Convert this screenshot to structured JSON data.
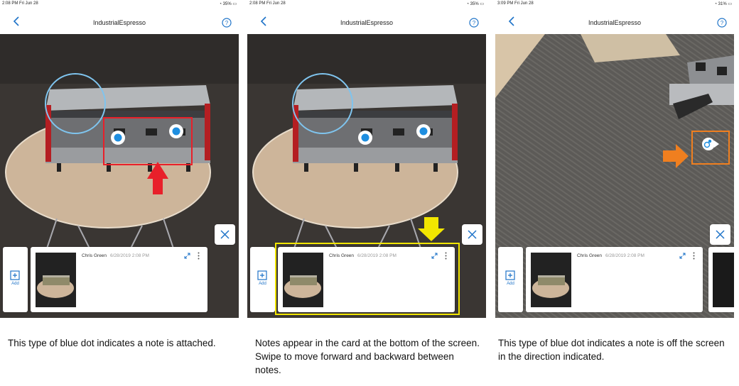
{
  "panels": [
    {
      "status_time": "2:08 PM  Fri Jun 28",
      "status_right": "35%",
      "title": "IndustrialEspresso",
      "add_label": "Add",
      "note_author": "Chris Green",
      "note_date": "6/28/2019 2:08 PM",
      "caption": "This type of blue dot indicates a note is attached."
    },
    {
      "status_time": "2:08 PM  Fri Jun 28",
      "status_right": "35%",
      "title": "IndustrialEspresso",
      "add_label": "Add",
      "note_author": "Chris Green",
      "note_date": "6/28/2019 2:08 PM",
      "caption": "Notes appear in the card at the bottom of the screen. Swipe to move forward and backward between notes."
    },
    {
      "status_time": "3:09 PM  Fri Jun 28",
      "status_right": "31%",
      "title": "IndustrialEspresso",
      "add_label": "Add",
      "note_author": "Chris Green",
      "note_date": "6/28/2019 2:08 PM",
      "caption": "This type of blue dot indicates a note is off the screen in the direction indicated."
    }
  ],
  "icons": {
    "back": "chevron-left-icon",
    "help": "help-circle-icon",
    "add": "add-note-icon",
    "expand": "expand-icon",
    "more": "more-vertical-icon",
    "close": "close-icon",
    "note_dot": "note-marker-icon",
    "offscreen_note": "offscreen-note-icon"
  },
  "colors": {
    "accent": "#1e73c8",
    "annotation_red": "#e8202a",
    "annotation_yellow": "#f2e600",
    "annotation_orange": "#f07f1f"
  }
}
